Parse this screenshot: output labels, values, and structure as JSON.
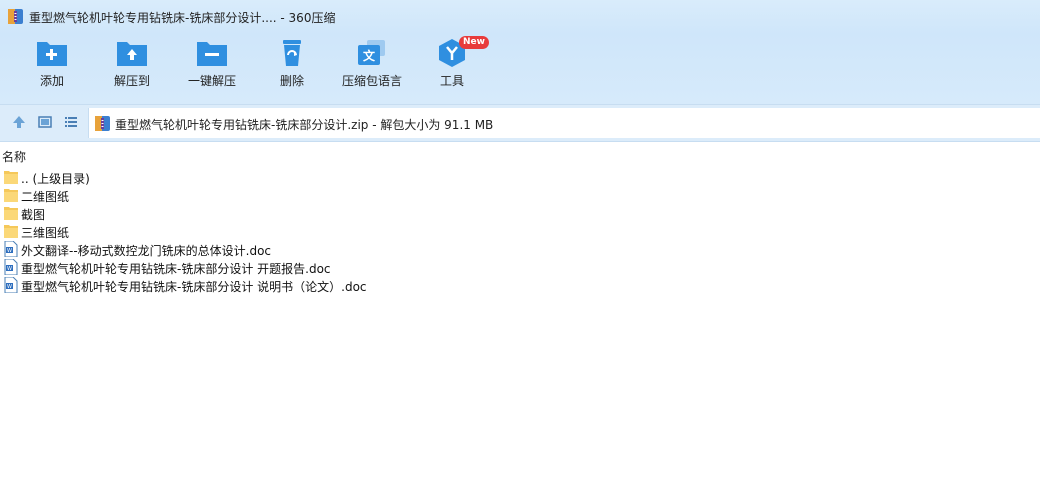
{
  "window": {
    "title": "重型燃气轮机叶轮专用钻铣床-铣床部分设计.... - 360压缩"
  },
  "toolbar": {
    "buttons": [
      {
        "label": "添加",
        "icon": "add-icon"
      },
      {
        "label": "解压到",
        "icon": "extract-to-icon"
      },
      {
        "label": "一键解压",
        "icon": "one-click-extract-icon"
      },
      {
        "label": "删除",
        "icon": "delete-icon"
      },
      {
        "label": "压缩包语言",
        "icon": "language-icon"
      },
      {
        "label": "工具",
        "icon": "tools-icon",
        "badge": "New"
      }
    ]
  },
  "addressbar": {
    "path": "重型燃气轮机叶轮专用钻铣床-铣床部分设计.zip - 解包大小为 91.1 MB"
  },
  "filelist": {
    "column_name": "名称",
    "items": [
      {
        "name": ".. (上级目录)",
        "type": "folder"
      },
      {
        "name": "二维图纸",
        "type": "folder"
      },
      {
        "name": "截图",
        "type": "folder"
      },
      {
        "name": "三维图纸",
        "type": "folder"
      },
      {
        "name": "外文翻译--移动式数控龙门铣床的总体设计.doc",
        "type": "doc"
      },
      {
        "name": "重型燃气轮机叶轮专用钻铣床-铣床部分设计 开题报告.doc",
        "type": "doc"
      },
      {
        "name": "重型燃气轮机叶轮专用钻铣床-铣床部分设计 说明书（论文）.doc",
        "type": "doc"
      }
    ]
  },
  "colors": {
    "accent": "#2f8fe0",
    "folder": "#f5c85a",
    "badge": "#e83b3b"
  }
}
